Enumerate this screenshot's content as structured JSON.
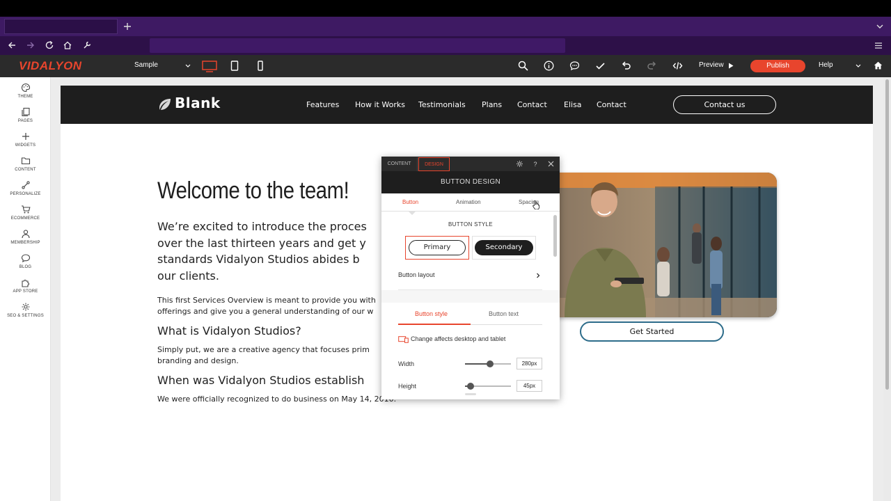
{
  "toolbar": {
    "logo": "VIDALYON",
    "page_select": "Sample",
    "preview_label": "Preview",
    "publish_label": "Publish",
    "help_label": "Help",
    "brand_color": "#e8452d"
  },
  "sidebar": {
    "items": [
      {
        "label": "THEME",
        "icon": "palette-icon"
      },
      {
        "label": "PAGES",
        "icon": "pages-icon"
      },
      {
        "label": "WIDGETS",
        "icon": "plus-icon"
      },
      {
        "label": "CONTENT",
        "icon": "folder-icon"
      },
      {
        "label": "PERSONALIZE",
        "icon": "personalize-icon"
      },
      {
        "label": "ECOMMERCE",
        "icon": "cart-icon"
      },
      {
        "label": "MEMBERSHIP",
        "icon": "user-icon"
      },
      {
        "label": "BLOG",
        "icon": "chat-icon"
      },
      {
        "label": "APP STORE",
        "icon": "puzzle-icon"
      },
      {
        "label": "SEO & SETTINGS",
        "icon": "gear-icon"
      }
    ]
  },
  "site": {
    "brand": "Blank",
    "nav": [
      "Features",
      "How it Works",
      "Testimonials",
      "Plans",
      "Contact",
      "Elisa",
      "Contact"
    ],
    "cta": "Contact us",
    "headline": "Welcome to the team!",
    "lead_lines": [
      "We’re excited to introduce the proces",
      "over the last thirteen years and get y",
      "standards Vidalyon Studios abides b",
      "our clients."
    ],
    "intro_lines": [
      "This first Services Overview is meant to provide you with",
      "offerings and give you a general understanding of our w"
    ],
    "h2_what": "What is Vidalyon Studios?",
    "what_lines": [
      "Simply put, we are a creative agency that focuses prim",
      "branding and design."
    ],
    "h2_when": "When was Vidalyon Studios establish",
    "when_text": "We were officially recognized to do business on May 14, 2010.",
    "get_started": "Get Started"
  },
  "panel": {
    "tab_content": "CONTENT",
    "tab_design": "DESIGN",
    "help_glyph": "?",
    "title": "BUTTON DESIGN",
    "subtabs": [
      "Button",
      "Animation",
      "Spacing"
    ],
    "button_style_title": "BUTTON STYLE",
    "primary_label": "Primary",
    "secondary_label": "Secondary",
    "button_layout_label": "Button layout",
    "inner_tabs": [
      "Button style",
      "Button text"
    ],
    "change_note": "Change affects desktop and tablet",
    "width_label": "Width",
    "width_value": "280px",
    "width_slider_fraction": 0.55,
    "height_label": "Height",
    "height_value": "45px",
    "height_slider_fraction": 0.12
  }
}
